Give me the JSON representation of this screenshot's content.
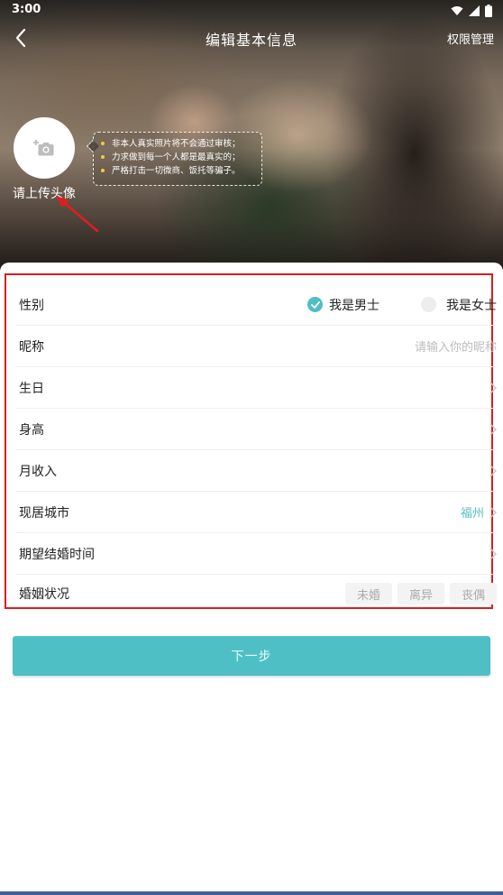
{
  "status": {
    "time": "3:00"
  },
  "header": {
    "title": "编辑基本信息",
    "right_action": "权限管理"
  },
  "avatar": {
    "label": "请上传头像"
  },
  "tips": [
    "非本人真实照片将不会通过审核；",
    "力求做到每一个人都是最真实的；",
    "严格打击一切微商、饭托等骗子。"
  ],
  "form": {
    "gender": {
      "label": "性别",
      "male": "我是男士",
      "female": "我是女士",
      "selected": "male"
    },
    "nickname": {
      "label": "昵称",
      "placeholder": "请输入你的昵称"
    },
    "birthday": {
      "label": "生日"
    },
    "height": {
      "label": "身高"
    },
    "income": {
      "label": "月收入"
    },
    "city": {
      "label": "现居城市",
      "value": "福州"
    },
    "marriage_time": {
      "label": "期望结婚时间"
    },
    "marital": {
      "label": "婚姻状况",
      "options": [
        "未婚",
        "离异",
        "丧偶"
      ]
    }
  },
  "next_button": "下一步",
  "colors": {
    "accent": "#4fbfc6",
    "highlight_border": "#d81e1e",
    "annotation_arrow": "#e01e1e"
  },
  "icons": {
    "back": "chevron-left-icon",
    "camera": "camera-add-icon",
    "chevron": "chevron-right-icon",
    "check": "check-icon",
    "wifi": "wifi-icon",
    "signal": "signal-icon",
    "battery": "battery-icon"
  }
}
